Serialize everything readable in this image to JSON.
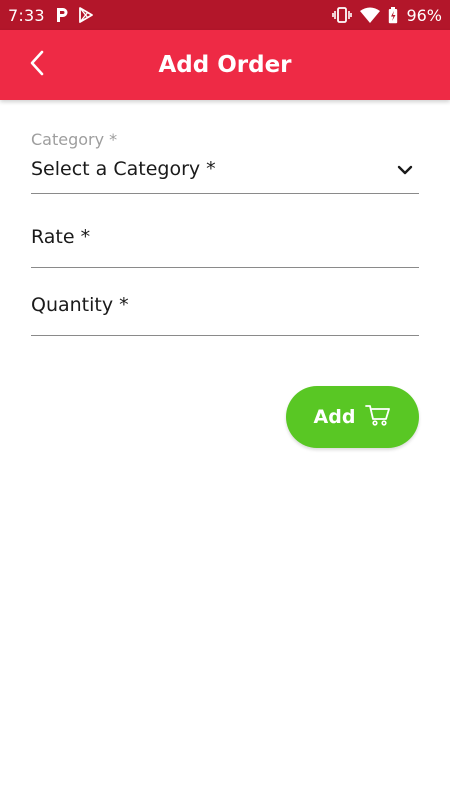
{
  "status_bar": {
    "time": "7:33",
    "battery": "96%",
    "icons": [
      "parking-app-icon",
      "play-store-icon",
      "vibrate-icon",
      "wifi-icon",
      "battery-icon"
    ]
  },
  "app_bar": {
    "title": "Add Order",
    "back_icon": "chevron-left-icon",
    "color": "#ee2a45"
  },
  "form": {
    "category": {
      "label": "Category *",
      "value": "Select a Category *",
      "icon": "chevron-down-icon"
    },
    "rate": {
      "placeholder": "Rate *"
    },
    "quantity": {
      "placeholder": "Quantity *"
    }
  },
  "add_button": {
    "label": "Add",
    "icon": "cart-icon",
    "color": "#59c724"
  }
}
